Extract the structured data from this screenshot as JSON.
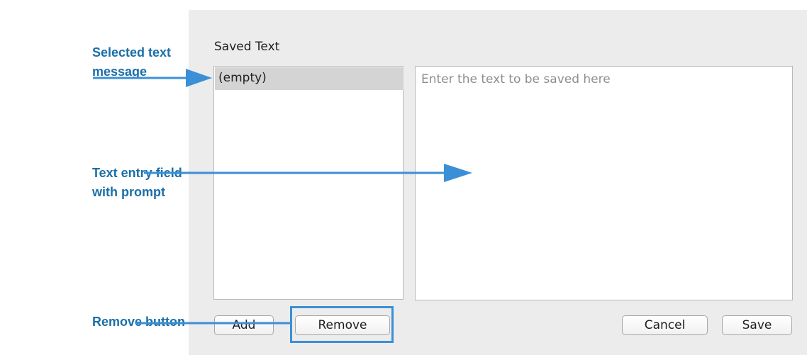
{
  "dialog": {
    "section_title": "Saved Text",
    "list_items": [
      "(empty)"
    ],
    "text_field_placeholder": "Enter the text to be saved here",
    "text_field_value": "",
    "buttons": {
      "add": "Add",
      "remove": "Remove",
      "cancel": "Cancel",
      "save": "Save"
    }
  },
  "callouts": {
    "selected_text_line1": "Selected text",
    "selected_text_line2": "message",
    "text_entry_line1": "Text entry field",
    "text_entry_line2": "with prompt",
    "remove_button": "Remove button"
  },
  "colors": {
    "callout_text": "#1a6fa8",
    "callout_arrow": "#3b8fd6",
    "panel_background": "#ececec",
    "selected_row": "#d4d4d4"
  }
}
